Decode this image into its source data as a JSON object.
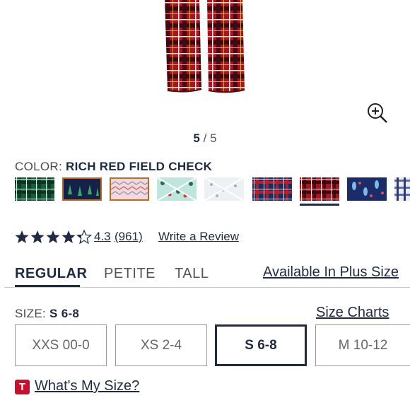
{
  "gallery": {
    "current": "5",
    "separator": "/",
    "total": "5",
    "zoom_icon": "zoom-in-icon"
  },
  "color": {
    "label": "COLOR:",
    "selected": "RICH RED FIELD CHECK",
    "swatches": [
      {
        "name": "green-plaid",
        "selected": false,
        "unavailable": false
      },
      {
        "name": "navy-trees",
        "selected": false,
        "unavailable": false
      },
      {
        "name": "pink-chevron",
        "selected": false,
        "unavailable": false
      },
      {
        "name": "mint-pattern",
        "selected": false,
        "unavailable": true
      },
      {
        "name": "white-pattern",
        "selected": false,
        "unavailable": true
      },
      {
        "name": "navy-red-plaid",
        "selected": false,
        "unavailable": false
      },
      {
        "name": "rich-red-field-check",
        "selected": true,
        "unavailable": false
      },
      {
        "name": "navy-print",
        "selected": false,
        "unavailable": false
      },
      {
        "name": "partial-plaid",
        "selected": false,
        "unavailable": false
      }
    ]
  },
  "rating": {
    "stars": 4.3,
    "value": "4.3",
    "count": "(961)",
    "write_review": "Write a Review"
  },
  "fit_tabs": {
    "items": [
      "REGULAR",
      "PETITE",
      "TALL"
    ],
    "active": "REGULAR",
    "plus_link": "Available In Plus Size"
  },
  "size": {
    "label": "SIZE:",
    "selected": "S 6-8",
    "size_charts": "Size Charts",
    "options": [
      "XXS 00-0",
      "XS 2-4",
      "S 6-8",
      "M 10-12"
    ],
    "whats_my_size": "What's My Size?",
    "badge_letter": "T"
  },
  "colors": {
    "navy": "#1f2a44",
    "badge_red": "#c8102e",
    "plaid_red": "#b01e2a"
  }
}
